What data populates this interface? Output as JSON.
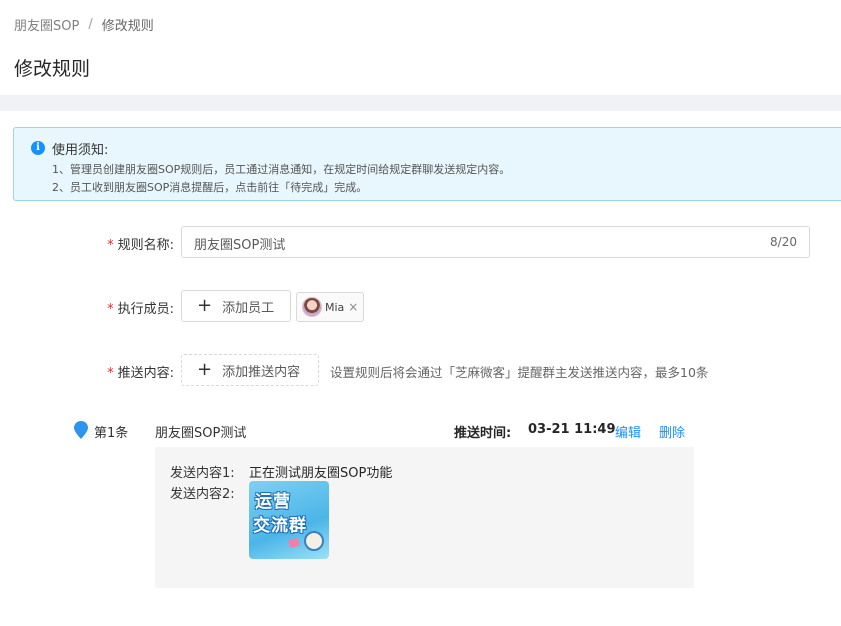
{
  "breadcrumb": {
    "parent": "朋友圈SOP",
    "separator": "/",
    "current": "修改规则"
  },
  "page": {
    "title": "修改规则"
  },
  "notice": {
    "icon": "info-icon",
    "title": "使用须知:",
    "lines": [
      "1、管理员创建朋友圈SOP规则后，员工通过消息通知，在规定时间给规定群聊发送规定内容。",
      "2、员工收到朋友圈SOP消息提醒后，点击前往「待完成」完成。"
    ]
  },
  "form": {
    "rule_name": {
      "label": "规则名称:",
      "value": "朋友圈SOP测试",
      "count": "8/20"
    },
    "members": {
      "label": "执行成员:",
      "add_label": "添加员工",
      "tags": [
        {
          "name": "Mia",
          "close": "×"
        }
      ]
    },
    "content": {
      "label": "推送内容:",
      "add_label": "添加推送内容",
      "hint": "设置规则后将会通过「芝麻微客」提醒群主发送推送内容，最多10条"
    }
  },
  "items": [
    {
      "index": "第1条",
      "title": "朋友圈SOP测试",
      "time_label": "推送时间:",
      "time": "03-21 11:49",
      "edit": "编辑",
      "delete": "删除",
      "contents": [
        {
          "label": "发送内容1:",
          "text": "正在测试朋友圈SOP功能"
        },
        {
          "label": "发送内容2:",
          "image_text": [
            "运营",
            "交流群"
          ]
        }
      ]
    }
  ],
  "colors": {
    "primary": "#1890ff",
    "required": "#f5222d",
    "notice_bg": "#e8f6fd",
    "notice_border": "#9bd5ef"
  }
}
